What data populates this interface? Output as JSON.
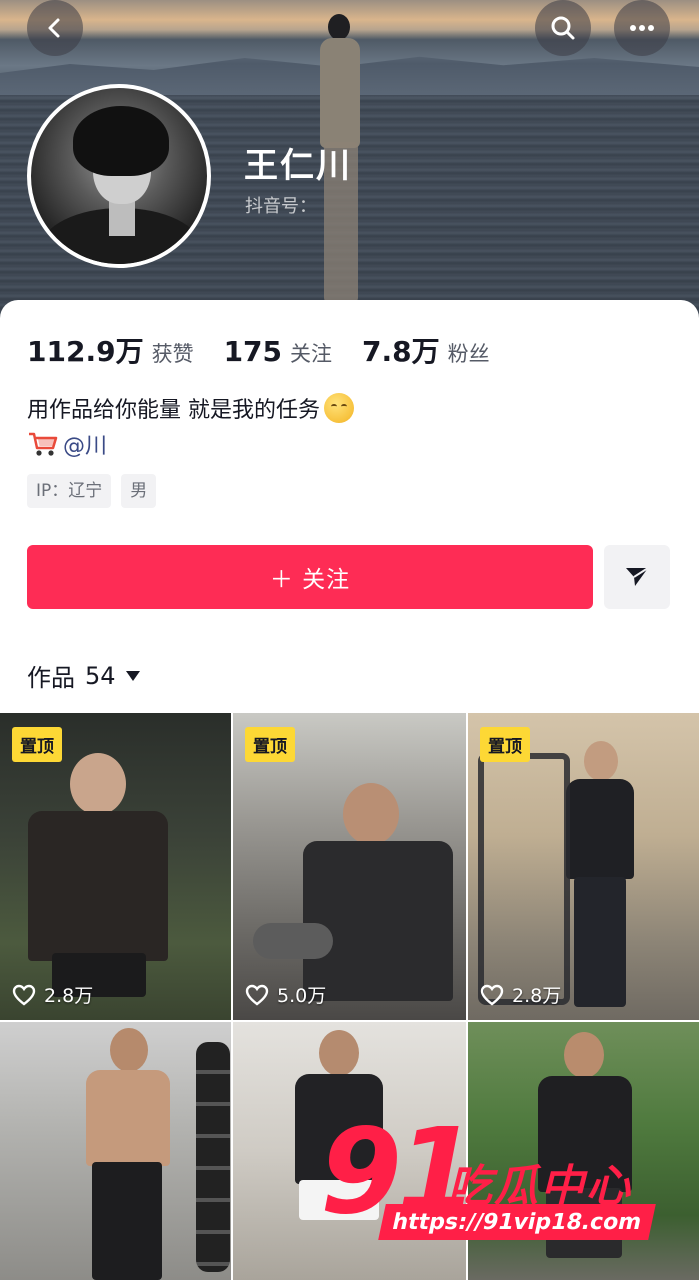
{
  "header": {
    "back_icon": "chevron-left-icon",
    "search_icon": "search-icon",
    "more_icon": "more-dots-icon"
  },
  "profile": {
    "name": "王仁川",
    "douyin_id_label": "抖音号：",
    "stats": [
      {
        "value": "112.9万",
        "label": "获赞"
      },
      {
        "value": "175",
        "label": "关注"
      },
      {
        "value": "7.8万",
        "label": "粉丝"
      }
    ],
    "bio": "用作品给你能量 就是我的任务",
    "shop_mention": "@川",
    "tags": [
      "IP：辽宁",
      "男"
    ],
    "follow_label": "＋ 关注"
  },
  "works": {
    "label": "作品",
    "count": "54",
    "items": [
      {
        "pinned": "置顶",
        "likes": "2.8万"
      },
      {
        "pinned": "置顶",
        "likes": "5.0万"
      },
      {
        "pinned": "置顶",
        "likes": "2.8万"
      },
      {
        "pinned": "",
        "likes": ""
      },
      {
        "pinned": "",
        "likes": ""
      },
      {
        "pinned": "",
        "likes": ""
      }
    ]
  },
  "watermark": {
    "number": "91",
    "text": "吃瓜中心",
    "url": "https://91vip18.com"
  },
  "colors": {
    "accent": "#fe2c55",
    "pin_badge": "#fdd835",
    "watermark": "#ff1f47"
  }
}
